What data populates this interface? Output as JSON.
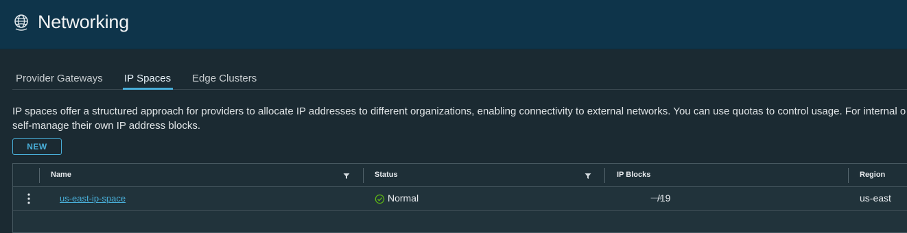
{
  "header": {
    "title": "Networking",
    "icon": "globe-icon"
  },
  "tabs": [
    {
      "label": "Provider Gateways",
      "active": false
    },
    {
      "label": "IP Spaces",
      "active": true
    },
    {
      "label": "Edge Clusters",
      "active": false
    }
  ],
  "description": {
    "line1": "IP spaces offer a structured approach for providers to allocate IP addresses to different organizations, enabling connectivity to external networks. You can use quotas to control usage. For internal o",
    "line2": "self-manage their own IP address blocks."
  },
  "toolbar": {
    "new_label": "NEW"
  },
  "grid": {
    "columns": [
      {
        "label": "Name",
        "filterable": true
      },
      {
        "label": "Status",
        "filterable": true
      },
      {
        "label": "IP Blocks",
        "filterable": false
      },
      {
        "label": "Region",
        "filterable": false
      }
    ],
    "rows": [
      {
        "name": "us-east-ip-space",
        "status": "Normal",
        "status_icon": "check-circle-icon",
        "ip_blocks": "/19",
        "ip_blocks_prefix_icon": "arrow-right-icon",
        "region": "us-east"
      }
    ]
  },
  "colors": {
    "header_bg": "#0e344a",
    "content_bg": "#1b2a32",
    "accent": "#49afd9",
    "status_ok": "#5eb715"
  }
}
